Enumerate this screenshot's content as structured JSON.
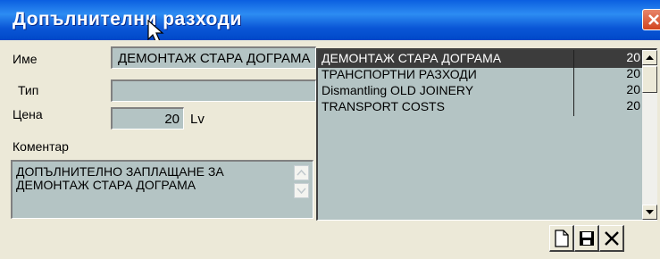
{
  "window": {
    "title": "Допълнителни разходи"
  },
  "form": {
    "name_label": "Име",
    "name_value": "ДЕМОНТАЖ СТАРА ДОГРАМА",
    "type_label": "Тип",
    "type_value": "",
    "price_label": "Цена",
    "price_value": "20",
    "currency": "Lv",
    "comment_label": "Коментар",
    "comment_value": "ДОПЪЛНИТЕЛНО ЗАПЛАЩАНЕ ЗА ДЕМОНТАЖ СТАРА ДОГРАМА"
  },
  "list": {
    "items": [
      {
        "name": "ДЕМОНТАЖ СТАРА ДОГРАМА",
        "value": "20",
        "selected": true
      },
      {
        "name": "ТРАНСПОРТНИ РАЗХОДИ",
        "value": "20",
        "selected": false
      },
      {
        "name": "Dismantling OLD JOINERY",
        "value": "20",
        "selected": false
      },
      {
        "name": "TRANSPORT COSTS",
        "value": "20",
        "selected": false
      }
    ]
  },
  "toolbar": {
    "new_icon": "new-document-icon",
    "save_icon": "save-floppy-icon",
    "delete_icon": "close-x-icon"
  },
  "colors": {
    "title_bar": "#0b5fe0",
    "field_bg": "#b4c4c4",
    "window_bg": "#ece9d8",
    "selection": "#3c3c3c"
  }
}
